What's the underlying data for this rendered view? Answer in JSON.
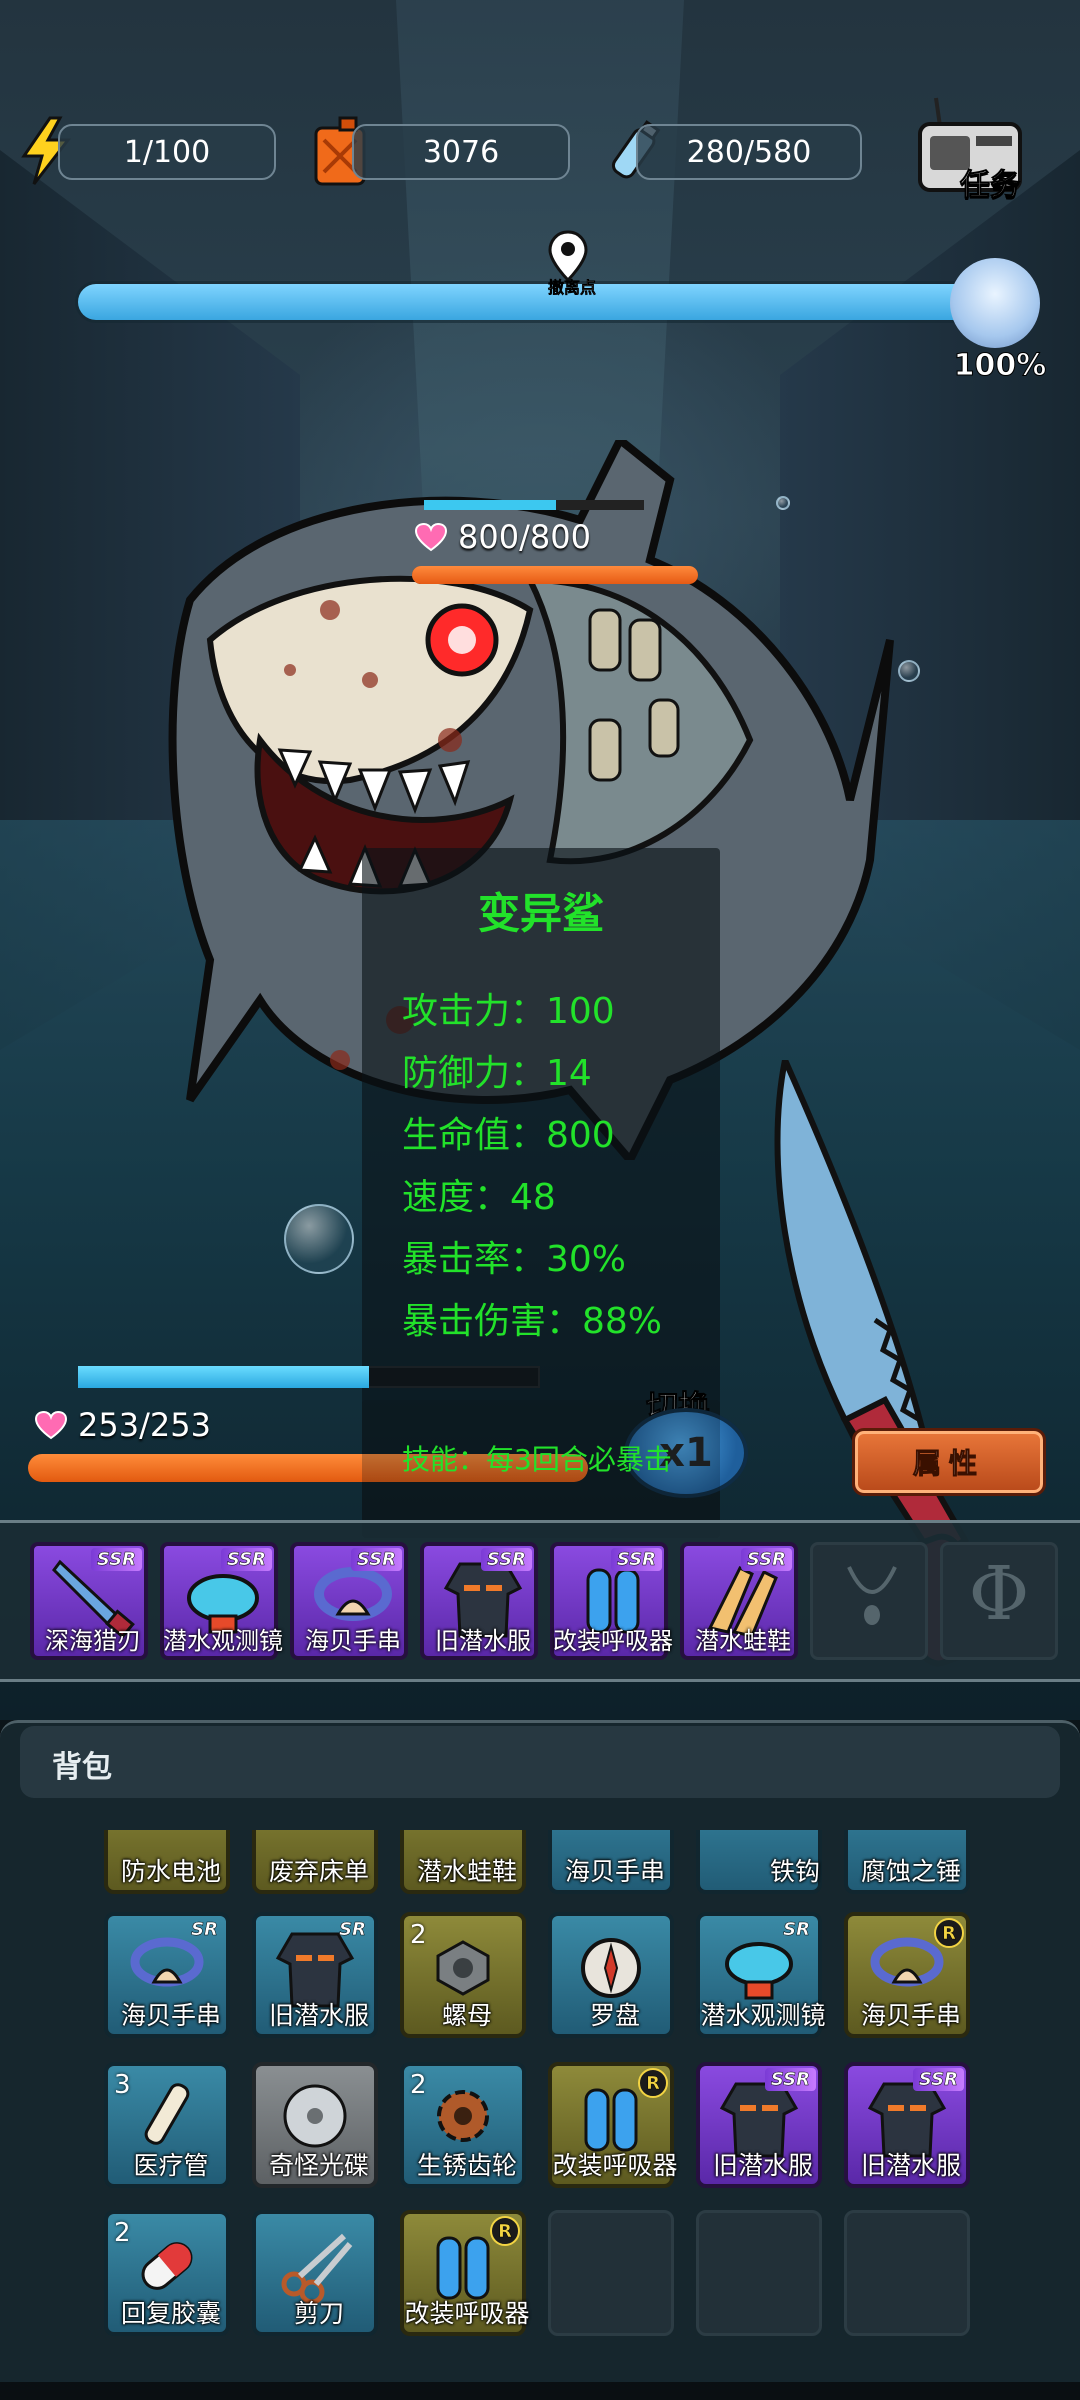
{
  "resources": {
    "energy": "1/100",
    "fuel": "3076",
    "water": "280/580",
    "task_label": "任务"
  },
  "progress": {
    "pin_label": "撤离点",
    "percent": "100%",
    "value": 1.0
  },
  "enemy": {
    "hp": "800/800",
    "hp_fraction": 1.0,
    "shield_fraction": 0.6,
    "name": "变异鲨"
  },
  "stats": {
    "attack": "攻击力：100",
    "defense": "防御力：14",
    "hp": "生命值：800",
    "speed": "速度：48",
    "crit_rate": "暴击率：30%",
    "crit_damage": "暴击伤害：88%",
    "skill": "技能：每3回合必暴击"
  },
  "player": {
    "hp": "253/253",
    "hp_fraction": 1.0,
    "shield_fraction": 0.63
  },
  "controls": {
    "switch_label": "切换",
    "speed": "x1",
    "attributes_button": "属性"
  },
  "equipment": [
    {
      "label": "深海猎刃",
      "rarity": "SSR",
      "icon": "knife-icon"
    },
    {
      "label": "潜水观测镜",
      "rarity": "SSR",
      "icon": "goggles-icon"
    },
    {
      "label": "海贝手串",
      "rarity": "SSR",
      "icon": "shell-bracelet-icon"
    },
    {
      "label": "旧潜水服",
      "rarity": "SSR",
      "icon": "wetsuit-icon"
    },
    {
      "label": "改装呼吸器",
      "rarity": "SSR",
      "icon": "tank-icon"
    },
    {
      "label": "潜水蛙鞋",
      "rarity": "SSR",
      "icon": "flippers-icon"
    }
  ],
  "empty_slots": [
    "necklace-slot-icon",
    "phi-slot-icon"
  ],
  "phi_glyph": "Φ",
  "backpack": {
    "title": "背包",
    "row0": [
      {
        "label": "防水电池",
        "color": "yellow"
      },
      {
        "label": "废弃床单",
        "color": "yellow"
      },
      {
        "label": "潜水蛙鞋",
        "color": "yellow"
      },
      {
        "label": "海贝手串",
        "color": "blue"
      },
      {
        "label": "铁钩",
        "color": "blue"
      },
      {
        "label": "腐蚀之锤",
        "color": "blue"
      }
    ],
    "row1": [
      {
        "label": "海贝手串",
        "color": "blue",
        "badge": "SR",
        "count": ""
      },
      {
        "label": "旧潜水服",
        "color": "blue",
        "badge": "SR",
        "count": ""
      },
      {
        "label": "螺母",
        "color": "yellow",
        "badge": "",
        "count": "2"
      },
      {
        "label": "罗盘",
        "color": "blue",
        "badge": "",
        "count": ""
      },
      {
        "label": "潜水观测镜",
        "color": "blue",
        "badge": "SR",
        "count": ""
      },
      {
        "label": "海贝手串",
        "color": "yellow",
        "badge": "R",
        "count": ""
      }
    ],
    "row2": [
      {
        "label": "医疗管",
        "color": "blue",
        "badge": "",
        "count": "3"
      },
      {
        "label": "奇怪光碟",
        "color": "gray",
        "badge": "",
        "count": ""
      },
      {
        "label": "生锈齿轮",
        "color": "blue",
        "badge": "",
        "count": "2"
      },
      {
        "label": "改装呼吸器",
        "color": "yellow",
        "badge": "R",
        "count": ""
      },
      {
        "label": "旧潜水服",
        "color": "purple",
        "badge": "SSR",
        "count": ""
      },
      {
        "label": "旧潜水服",
        "color": "purple",
        "badge": "SSR",
        "count": ""
      }
    ],
    "row3": [
      {
        "label": "回复胶囊",
        "color": "blue",
        "badge": "",
        "count": "2"
      },
      {
        "label": "剪刀",
        "color": "blue",
        "badge": "",
        "count": ""
      },
      {
        "label": "改装呼吸器",
        "color": "yellow",
        "badge": "R",
        "count": ""
      }
    ]
  },
  "colors": {
    "stat_text": "#22e22a",
    "hp_orange": "#e65a14",
    "shield_blue": "#3cc8f0",
    "ssr_purple": "#7b3bd6"
  }
}
